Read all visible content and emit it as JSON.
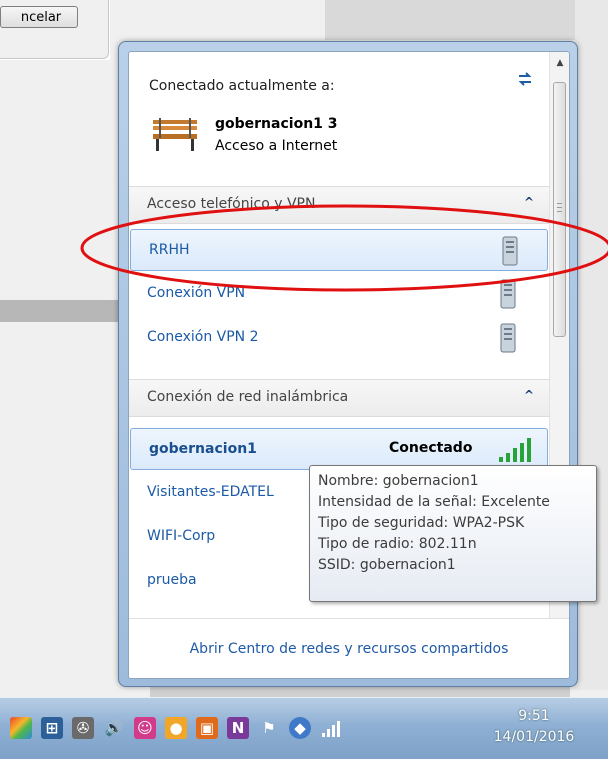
{
  "background": {
    "cancel_button_label": "ncelar"
  },
  "popup": {
    "header_label": "Conectado actualmente a:",
    "refresh_icon": "refresh-arrows-icon",
    "current_network": {
      "name": "gobernacion1  3",
      "access": "Acceso a Internet",
      "icon": "park-bench-icon"
    },
    "sections": [
      {
        "label": "Acceso telefónico y VPN",
        "toggle": "^",
        "items": [
          {
            "label": "RRHH",
            "icon": "vpn-server-icon",
            "selected": true
          },
          {
            "label": "Conexión VPN",
            "icon": "vpn-server-icon"
          },
          {
            "label": "Conexión VPN 2",
            "icon": "vpn-server-icon"
          }
        ]
      },
      {
        "label": "Conexión de red inalámbrica",
        "toggle": "^",
        "items": [
          {
            "label": "gobernacion1",
            "status": "Conectado",
            "icon": "wifi-signal-icon",
            "selected": true
          },
          {
            "label": "Visitantes-EDATEL",
            "icon": "wifi-signal-icon"
          },
          {
            "label": "WIFI-Corp",
            "icon": "wifi-signal-icon"
          },
          {
            "label": "prueba",
            "icon": "wifi-signal-icon"
          }
        ]
      }
    ],
    "footer_link": "Abrir Centro de redes y recursos compartidos"
  },
  "tooltip": {
    "lines": [
      "Nombre: gobernacion1",
      "Intensidad de la señal: Excelente",
      "Tipo de seguridad: WPA2-PSK",
      "Tipo de radio: 802.11n",
      "SSID: gobernacion1"
    ]
  },
  "taskbar": {
    "time": "9:51",
    "date": "14/01/2016",
    "icons": [
      "windows-logo-icon",
      "grid-icon",
      "usb-plug-icon",
      "speaker-icon",
      "app-red-icon",
      "app-orange-icon",
      "app-green-icon",
      "onenote-icon",
      "flag-icon",
      "shield-icon",
      "network-signal-icon"
    ]
  },
  "colors": {
    "link": "#1a5aa6",
    "annotation": "#e01010",
    "signal_green": "#27a33a"
  }
}
